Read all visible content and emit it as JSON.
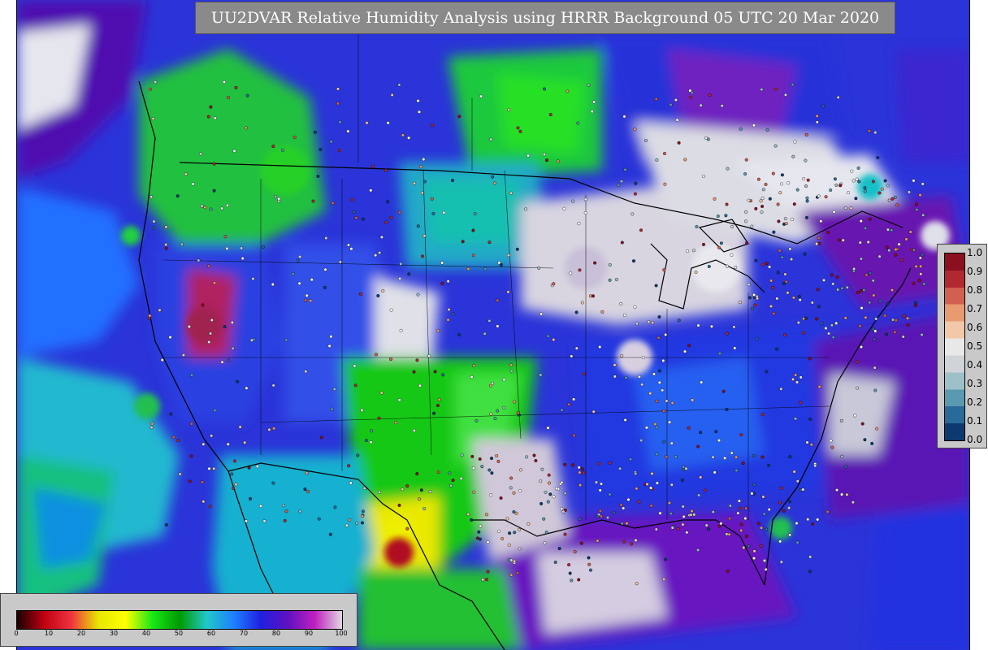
{
  "title": "UU2DVAR Relative Humidity Analysis using HRRR Background 05 UTC 20 Mar 2020",
  "rh_legend": {
    "ticks": [
      "0",
      "10",
      "20",
      "30",
      "40",
      "50",
      "60",
      "70",
      "80",
      "90",
      "100"
    ],
    "colors": [
      "#1a0000",
      "#c00010",
      "#ee3340",
      "#e6e600",
      "#ffff00",
      "#18e818",
      "#009a00",
      "#20c8c8",
      "#1e80ff",
      "#2020e0",
      "#6010c0",
      "#c020c0",
      "#e0d8e0"
    ]
  },
  "increment_legend": {
    "ticks": [
      "1.0",
      "0.9",
      "0.8",
      "0.7",
      "0.6",
      "0.5",
      "0.4",
      "0.3",
      "0.2",
      "0.1",
      "0.0"
    ],
    "colors": [
      "#8a1020",
      "#b02830",
      "#d06050",
      "#e89a70",
      "#f2c8a8",
      "#e8e8e8",
      "#d0d4d8",
      "#9ec0c8",
      "#5a9ab0",
      "#2a6a98",
      "#0c3a6e"
    ]
  }
}
